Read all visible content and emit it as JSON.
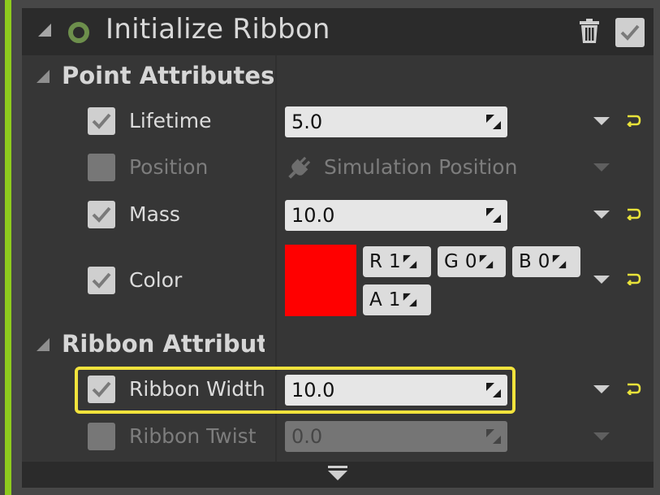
{
  "module": {
    "title": "Initialize Ribbon",
    "status_ring_color": "#6d8f4c",
    "accent_color": "#8ecb1e",
    "highlight_color": "#f2e33c"
  },
  "sections": {
    "point_attributes": "Point Attributes",
    "ribbon_attributes": "Ribbon Attributes"
  },
  "rows": {
    "lifetime": {
      "label": "Lifetime",
      "value": "5.0",
      "checked": true
    },
    "position": {
      "label": "Position",
      "value": "Simulation Position",
      "checked": false
    },
    "mass": {
      "label": "Mass",
      "value": "10.0",
      "checked": true
    },
    "color": {
      "label": "Color",
      "checked": true,
      "swatch": "#ff0000",
      "r_label": "R",
      "r_value": "1",
      "g_label": "G",
      "g_value": "0",
      "b_label": "B",
      "b_value": "0",
      "a_label": "A",
      "a_value": "1"
    },
    "ribbon_width": {
      "label": "Ribbon Width",
      "value": "10.0",
      "checked": true
    },
    "ribbon_twist": {
      "label": "Ribbon Twist",
      "value": "0.0",
      "checked": false
    }
  }
}
